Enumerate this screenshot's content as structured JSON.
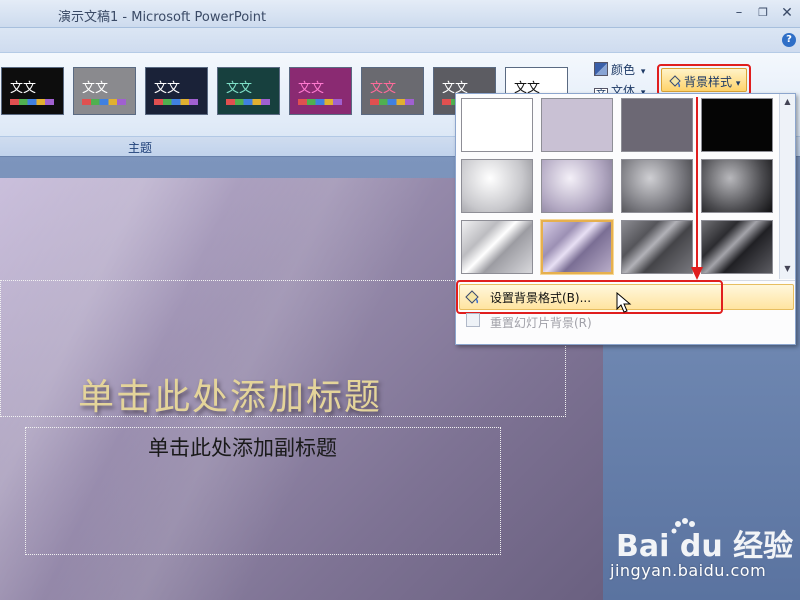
{
  "window": {
    "title": "演示文稿1 - Microsoft PowerPoint",
    "minimize_glyph": "–",
    "maximize_glyph": "❐",
    "close_glyph": "✕"
  },
  "ribbon": {
    "help_glyph": "?",
    "group_label": "主题",
    "themes": [
      {
        "label": "文文",
        "bg": "#0d0d0d",
        "text": "#ffffff"
      },
      {
        "label": "文文",
        "bg": "#8a8a8e",
        "text": "#ffffff"
      },
      {
        "label": "文文",
        "bg": "#1a2238",
        "text": "#ffffff"
      },
      {
        "label": "文文",
        "bg": "#17403e",
        "text": "#7fe0c8"
      },
      {
        "label": "文文",
        "bg": "#8a2a72",
        "text": "#ff7ad0"
      },
      {
        "label": "文文",
        "bg": "#6a6a70",
        "text": "#ff6a9a"
      },
      {
        "label": "文文",
        "bg": "#5c5c62",
        "text": "#ffffff"
      },
      {
        "label": "文文",
        "bg": "#ffffff",
        "text": "#111111"
      }
    ],
    "colors_label": "颜色",
    "fonts_label": "文体",
    "background_styles_label": "背景样式",
    "dropdown_arrow": "▾"
  },
  "dropdown": {
    "swatches": [
      {
        "bg": "#ffffff",
        "selected": false
      },
      {
        "bg": "#c9c1d4",
        "selected": false
      },
      {
        "bg": "#6c6874",
        "selected": false
      },
      {
        "bg": "#050505",
        "selected": false
      },
      {
        "bg": "radial-gradient(circle at 40% 35%, #ffffff, #c8c8cc 60%, #909096)",
        "selected": false
      },
      {
        "bg": "radial-gradient(circle at 40% 35%, #f4f0f8, #b2a8c2 60%, #7e7690)",
        "selected": false
      },
      {
        "bg": "radial-gradient(circle at 40% 35%, #cfcfd3, #77777d 60%, #3c3c40)",
        "selected": false
      },
      {
        "bg": "radial-gradient(circle at 40% 35%, #b8b8bc, #4c4c50 60%, #101012)",
        "selected": false
      },
      {
        "bg": "linear-gradient(135deg, #f0f0f2 0%, #bcbcc0 30%, #ffffff 45%, #9c9ca2 60%, #d8d8dc 100%)",
        "selected": false
      },
      {
        "bg": "linear-gradient(135deg, #d6cce6 0%, #9c90b4 30%, #e8e0f4 45%, #7a6e94 60%, #b8acc8 100%)",
        "selected": true
      },
      {
        "bg": "linear-gradient(135deg, #8c8c92 0%, #55555a 30%, #b2b2b8 45%, #444448 60%, #78787e 100%)",
        "selected": false
      },
      {
        "bg": "linear-gradient(135deg, #707074 0%, #2c2c30 30%, #a4a4aa 45%, #202024 60%, #5c5c62 100%)",
        "selected": false
      }
    ],
    "format_background_label": "设置背景格式(B)...",
    "reset_background_label": "重置幻灯片背景(R)",
    "scroll_up": "▲",
    "scroll_down": "▼"
  },
  "slide": {
    "title_placeholder": "单击此处添加标题",
    "subtitle_placeholder": "单击此处添加副标题"
  },
  "watermark": {
    "logo_text": "Bai du 经验",
    "url": "jingyan.baidu.com"
  }
}
